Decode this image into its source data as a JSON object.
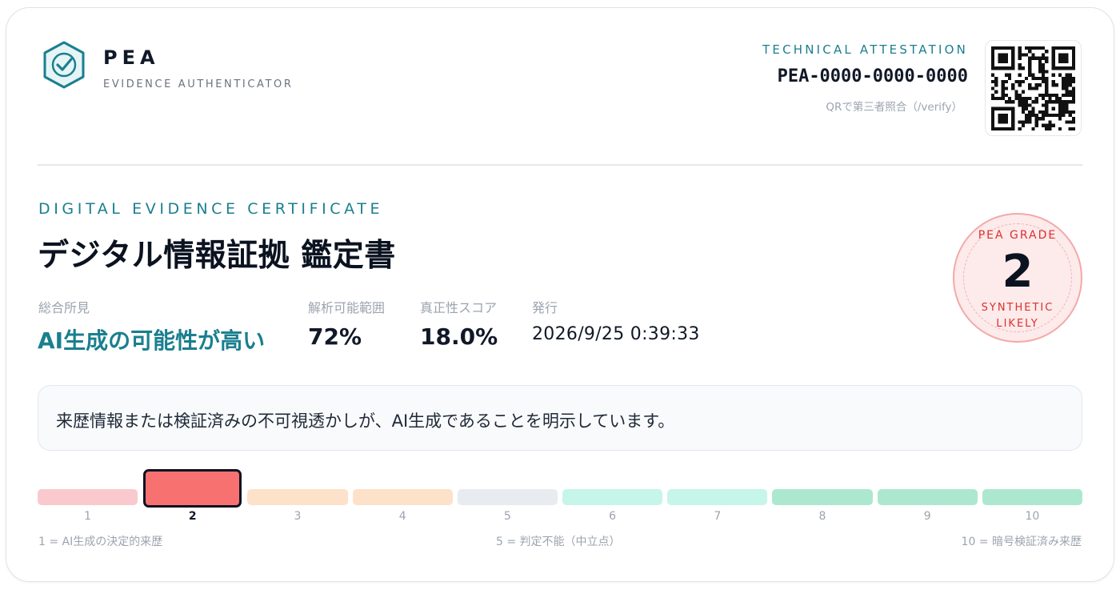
{
  "brand": {
    "name": "PEA",
    "subtitle": "EVIDENCE AUTHENTICATOR",
    "logo_icon": "hexagon-check-icon"
  },
  "attestation": {
    "label": "TECHNICAL ATTESTATION",
    "id": "PEA-0000-0000-0000",
    "qr_note": "QRで第三者照合（/verify）",
    "qr_icon": "qr-code-icon"
  },
  "certificate": {
    "label": "DIGITAL EVIDENCE CERTIFICATE",
    "title": "デジタル情報証拠 鑑定書",
    "stats": [
      {
        "label": "総合所見",
        "value": "AI生成の可能性が高い"
      },
      {
        "label": "解析可能範囲",
        "value": "72%"
      },
      {
        "label": "真正性スコア",
        "value": "18.0%"
      },
      {
        "label": "発行",
        "value": "2026/9/25 0:39:33"
      }
    ]
  },
  "stamp": {
    "label": "PEA GRADE",
    "grade": "2",
    "verdict_line1": "SYNTHETIC",
    "verdict_line2": "LIKELY"
  },
  "message": "来歴情報または検証済みの不可視透かしが、AI生成であることを明示しています。",
  "scale": {
    "selected": 2,
    "segments": [
      {
        "label": "1",
        "color": "#f9c9cd"
      },
      {
        "label": "2",
        "color": "#f87171"
      },
      {
        "label": "3",
        "color": "#fde1c8"
      },
      {
        "label": "4",
        "color": "#fde1c8"
      },
      {
        "label": "5",
        "color": "#e8ebef"
      },
      {
        "label": "6",
        "color": "#c6f5ea"
      },
      {
        "label": "7",
        "color": "#c6f5ea"
      },
      {
        "label": "8",
        "color": "#ace8d0"
      },
      {
        "label": "9",
        "color": "#ace8d0"
      },
      {
        "label": "10",
        "color": "#ace8d0"
      }
    ],
    "legend_left": "1 = AI生成の決定的来歴",
    "legend_mid": "5 = 判定不能（中立点）",
    "legend_right": "10 = 暗号検証済み来歴"
  },
  "colors": {
    "accent": "#1a7f8f",
    "stamp_red": "#dc2f2f"
  }
}
